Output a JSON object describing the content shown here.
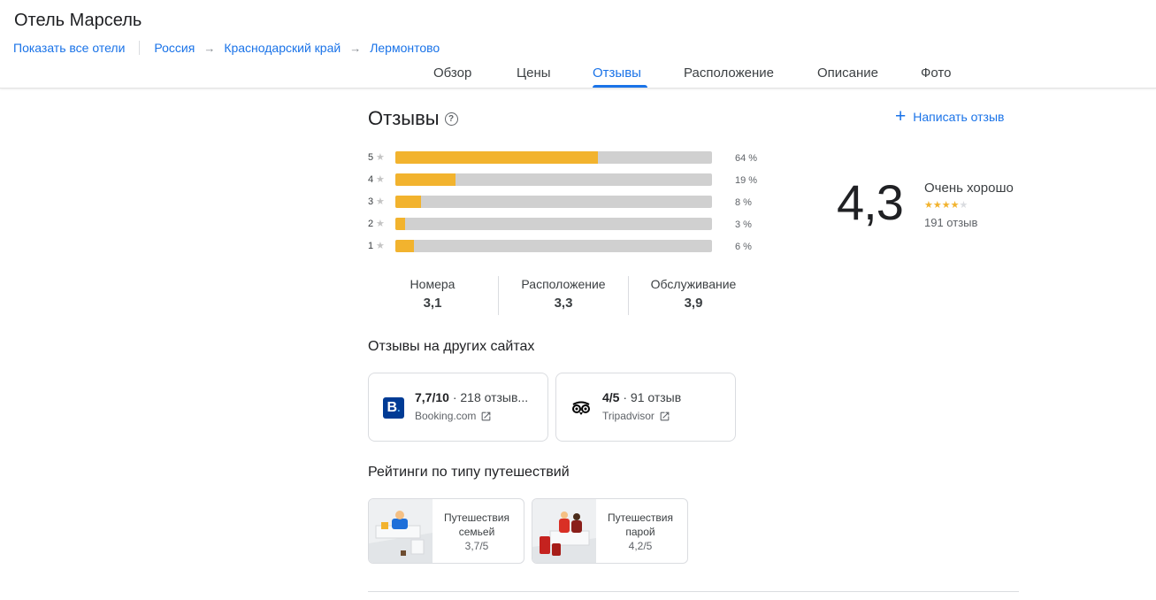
{
  "header": {
    "hotel_title": "Отель Марсель",
    "show_all_link": "Показать все отели",
    "breadcrumbs": [
      "Россия",
      "Краснодарский край",
      "Лермонтово"
    ],
    "arrow": "→"
  },
  "tabs": [
    "Обзор",
    "Цены",
    "Отзывы",
    "Расположение",
    "Описание",
    "Фото"
  ],
  "active_tab": "Отзывы",
  "reviews": {
    "title": "Отзывы",
    "help_icon": "?",
    "write_review": "Написать отзыв",
    "distribution": [
      {
        "stars": "5",
        "percent": 64,
        "label": "64 %"
      },
      {
        "stars": "4",
        "percent": 19,
        "label": "19 %"
      },
      {
        "stars": "3",
        "percent": 8,
        "label": "8 %"
      },
      {
        "stars": "2",
        "percent": 3,
        "label": "3 %"
      },
      {
        "stars": "1",
        "percent": 6,
        "label": "6 %"
      }
    ],
    "overall": {
      "score": "4,3",
      "label": "Очень хорошо",
      "stars_filled": 4,
      "stars_total": 5,
      "count": "191 отзыв"
    },
    "categories": [
      {
        "name": "Номера",
        "score": "3,1"
      },
      {
        "name": "Расположение",
        "score": "3,3"
      },
      {
        "name": "Обслуживание",
        "score": "3,9"
      }
    ]
  },
  "other_sites": {
    "title": "Отзывы на других сайтах",
    "sites": [
      {
        "score": "7,7/10",
        "reviews": " · 218 отзыв...",
        "name": "Booking.com",
        "icon": "booking-logo"
      },
      {
        "score": "4/5",
        "reviews": " · 91 отзыв",
        "name": "Tripadvisor",
        "icon": "tripadvisor-logo"
      }
    ]
  },
  "trip_types": {
    "title": "Рейтинги по типу путешествий",
    "items": [
      {
        "line1": "Путешествия",
        "line2": "семьей",
        "score": "3,7/5"
      },
      {
        "line1": "Путешествия",
        "line2": "парой",
        "score": "4,2/5"
      }
    ]
  },
  "colors": {
    "accent": "#1a73e8",
    "bar_fill": "#f2b32e",
    "bar_bg": "#d0d0d0",
    "booking": "#003b95"
  }
}
